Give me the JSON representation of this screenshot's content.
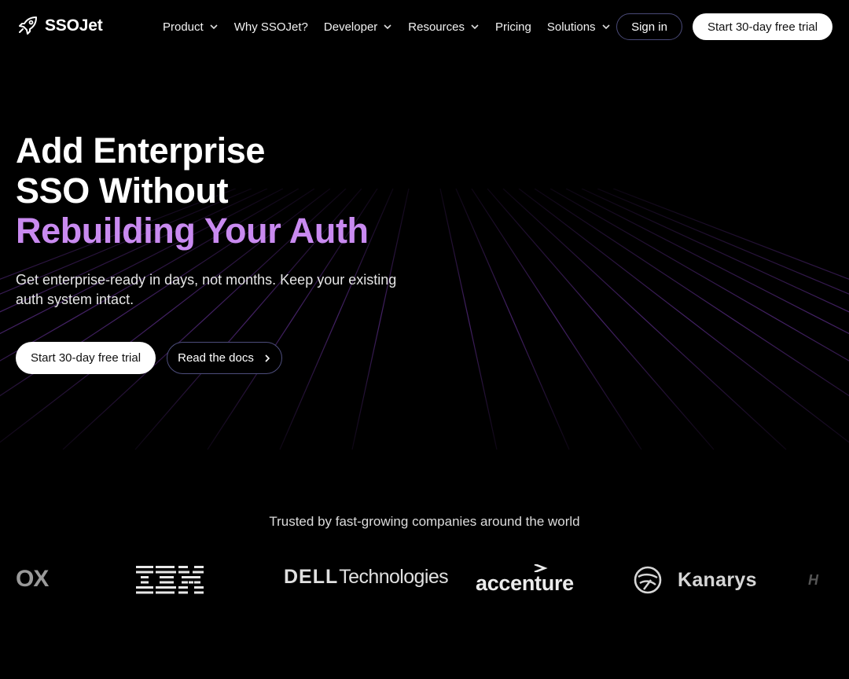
{
  "brand": {
    "name": "SSOJet"
  },
  "nav": {
    "items": [
      {
        "label": "Product",
        "dropdown": true
      },
      {
        "label": "Why SSOJet?",
        "dropdown": false
      },
      {
        "label": "Developer",
        "dropdown": true
      },
      {
        "label": "Resources",
        "dropdown": true
      },
      {
        "label": "Pricing",
        "dropdown": false
      },
      {
        "label": "Solutions",
        "dropdown": true
      }
    ],
    "sign_in": "Sign in",
    "trial": "Start 30-day free trial"
  },
  "hero": {
    "headline_line1": "Add Enterprise",
    "headline_line2": "SSO Without",
    "headline_accent": "Rebuilding Your Auth",
    "subtext": "Get enterprise-ready in days, not months. Keep your existing auth system intact.",
    "primary_cta": "Start 30-day free trial",
    "secondary_cta": "Read the docs"
  },
  "trusted": {
    "heading": "Trusted by fast-growing companies around the world",
    "logos": {
      "partial_left": "OX",
      "ibm": "IBM",
      "dell": "DELL",
      "dell_suffix": "Technologies",
      "accenture": "accenture",
      "kanarys": "Kanarys",
      "partial_right": "H"
    }
  },
  "colors": {
    "accent": "#c98af0",
    "grid_line": "#5b2a86",
    "background": "#000000"
  }
}
